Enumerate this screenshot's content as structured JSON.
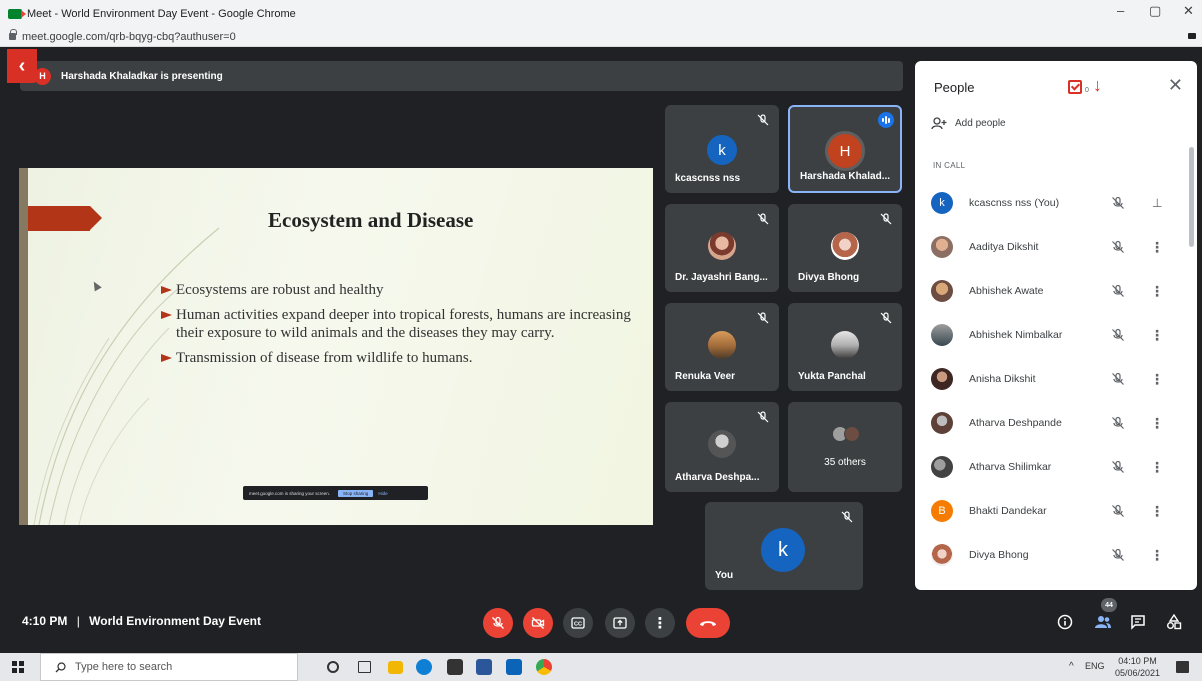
{
  "browser": {
    "title": "Meet - World Environment Day Event - Google Chrome",
    "url": "meet.google.com/qrb-bqyg-cbq?authuser=0",
    "minimize": "–",
    "maximize": "▢",
    "close": "✕"
  },
  "presenting": {
    "avatar_letter": "H",
    "text": "Harshada Khaladkar is presenting",
    "back_glyph": "‹"
  },
  "slide": {
    "title": "Ecosystem and Disease",
    "bullets": [
      "Ecosystems are robust and healthy",
      "Human activities expand deeper into tropical forests, humans are increasing their exposure to wild animals and the diseases they may carry.",
      "Transmission of disease from wildlife to humans."
    ],
    "share_banner": {
      "text": "meet.google.com is sharing your screen.",
      "stop_label": "Stop sharing",
      "hide_label": "Hide"
    }
  },
  "tiles": [
    {
      "name": "kcascnss nss",
      "avatar": "k",
      "avatar_color": "#1565c0",
      "muted": true
    },
    {
      "name": "Harshada Khalad...",
      "avatar": "H",
      "avatar_color": "#c1421f",
      "speaking": true
    },
    {
      "name": "Dr. Jayashri Bang...",
      "muted": true
    },
    {
      "name": "Divya Bhong",
      "muted": true
    },
    {
      "name": "Renuka Veer",
      "muted": true
    },
    {
      "name": "Yukta Panchal",
      "muted": true
    },
    {
      "name": "Atharva Deshpa...",
      "muted": true
    },
    {
      "name": "35 others"
    },
    {
      "name": "You",
      "avatar": "k",
      "avatar_color": "#1565c0",
      "muted": true
    }
  ],
  "people": {
    "title": "People",
    "raised_hands": "0",
    "add_people": "Add people",
    "section": "IN CALL",
    "list": [
      {
        "name": "kcascnss nss (You)",
        "avatar": "k",
        "color": "#1565c0",
        "pin": true
      },
      {
        "name": "Aaditya Dikshit",
        "color": "#8d6e63"
      },
      {
        "name": "Abhishek Awate",
        "color": "#6d4c41"
      },
      {
        "name": "Abhishek Nimbalkar",
        "color": "#37474f"
      },
      {
        "name": "Anisha Dikshit",
        "color": "#3e2723"
      },
      {
        "name": "Atharva Deshpande",
        "color": "#5d4037"
      },
      {
        "name": "Atharva Shilimkar",
        "color": "#424242"
      },
      {
        "name": "Bhakti Dandekar",
        "avatar": "B",
        "color": "#f57c00"
      },
      {
        "name": "Divya Bhong",
        "color": "#a1887f"
      }
    ]
  },
  "meeting": {
    "time": "4:10 PM",
    "separator": "|",
    "name": "World Environment Day Event",
    "participant_count": "44"
  },
  "taskbar": {
    "search_placeholder": "Type here to search",
    "lang": "ENG",
    "time": "04:10 PM",
    "date": "05/06/2021",
    "tray_arrow": "^"
  },
  "colors": {
    "meet_bg": "#202124",
    "tile_bg": "#3c4043",
    "danger": "#ea4335",
    "accent": "#8ab4f8"
  }
}
